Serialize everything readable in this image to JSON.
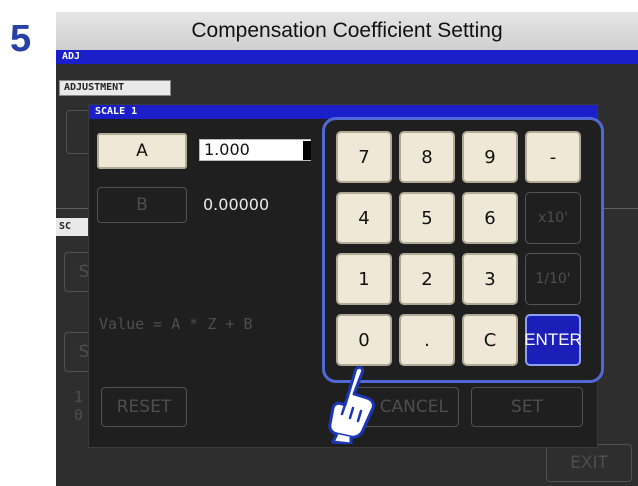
{
  "header": {
    "step": "5",
    "title": "Compensation Coefficient Setting"
  },
  "screen": {
    "top_bar_label": "ADJ",
    "tab_adjustment": "ADJUSTMENT",
    "tab_sc": "SC",
    "formula": "Value = A * Z + B",
    "reset_label": "RESET",
    "cancel_label": "CANCEL",
    "set_label": "SET",
    "exit_label": "EXIT",
    "left_partial": {
      "row1": "S",
      "row2": "S",
      "row3a": "1",
      "row3b": "0"
    }
  },
  "dialog": {
    "title": "SCALE 1",
    "coef_a": {
      "label": "A",
      "value": "1.000"
    },
    "coef_b": {
      "label": "B",
      "value": "0.00000"
    }
  },
  "keypad": {
    "keys": {
      "k7": "7",
      "k8": "8",
      "k9": "9",
      "minus": "-",
      "k4": "4",
      "k5": "5",
      "k6": "6",
      "x10": "x10'",
      "k1": "1",
      "k2": "2",
      "k3": "3",
      "div10": "1/10'",
      "k0": "0",
      "dot": ".",
      "clear": "C",
      "enter": "ENTER"
    }
  },
  "colors": {
    "accent_blue": "#1a1fc9",
    "keypad_highlight": "#5169d4",
    "key_face": "#efe8d6",
    "enter_key": "#1c1eb8"
  },
  "icons": {
    "pointer": "pointing-hand-icon"
  }
}
